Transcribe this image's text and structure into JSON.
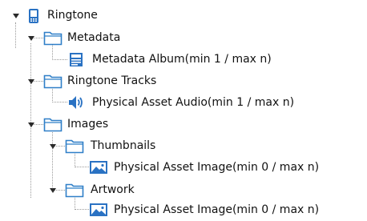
{
  "tree": {
    "root": {
      "label": "Ringtone",
      "icon": "phone-icon",
      "expanded": true,
      "children": [
        {
          "label": "Metadata",
          "icon": "folder-icon",
          "expanded": true,
          "children": [
            {
              "label": "Metadata Album(min 1 / max n)",
              "icon": "metadata-album-icon"
            }
          ]
        },
        {
          "label": "Ringtone Tracks",
          "icon": "folder-icon",
          "expanded": true,
          "children": [
            {
              "label": "Physical Asset Audio(min 1 / max n)",
              "icon": "speaker-icon"
            }
          ]
        },
        {
          "label": "Images",
          "icon": "folder-icon",
          "expanded": true,
          "children": [
            {
              "label": "Thumbnails",
              "icon": "folder-icon",
              "expanded": true,
              "children": [
                {
                  "label": "Physical Asset Image(min 0 / max n)",
                  "icon": "image-icon"
                }
              ]
            },
            {
              "label": "Artwork",
              "icon": "folder-icon",
              "expanded": true,
              "children": [
                {
                  "label": "Physical Asset Image(min 0 / max n)",
                  "icon": "image-icon"
                }
              ]
            }
          ]
        }
      ]
    }
  },
  "colors": {
    "folder_stroke": "#2f7fc8",
    "folder_fill": "#ffffff",
    "icon_blue": "#2a72c3",
    "guide_line": "#9a9a9a",
    "toggle_arrow": "#2a2a2a",
    "text": "#111111"
  }
}
